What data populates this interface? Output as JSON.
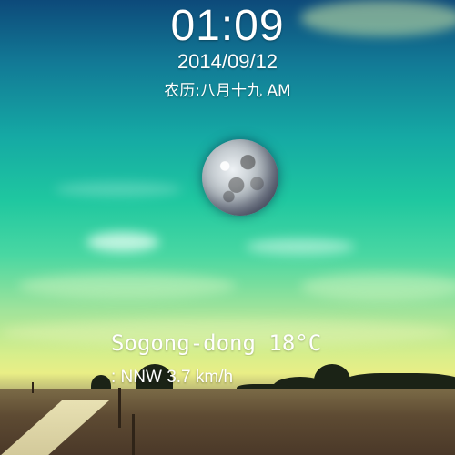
{
  "lockscreen": {
    "time": "01:09",
    "date": "2014/09/12",
    "lunar_date": "农历:八月十九  AM"
  },
  "weather": {
    "location_line": "Sogong-dong  18°C",
    "wind_line": ": NNW 3.7 km/h"
  },
  "colors": {
    "text": "#ffffff",
    "sky_top": "#0d4a7a",
    "sky_mid": "#1fc7a0",
    "horizon": "#e9ee86",
    "field": "#5e4b33"
  },
  "icons": {
    "moon": "moon-phase-icon"
  }
}
